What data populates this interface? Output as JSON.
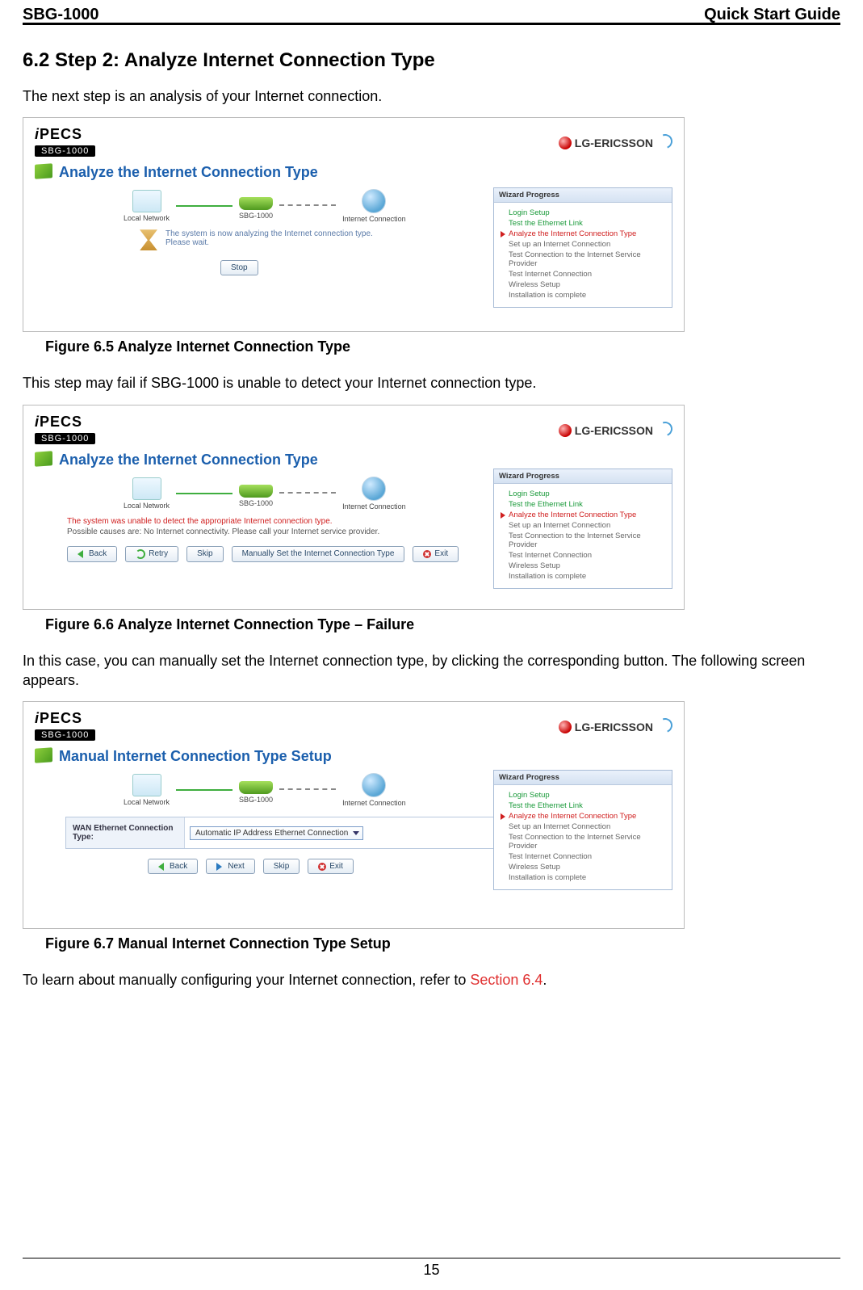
{
  "header": {
    "left": "SBG-1000",
    "right": "Quick Start Guide"
  },
  "section_title": "6.2 Step 2: Analyze Internet Connection Type",
  "para1": "The next step is an analysis of your Internet connection.",
  "caption1": "Figure 6.5 Analyze Internet Connection Type",
  "para2": "This step may fail if SBG-1000 is unable to detect your Internet connection type.",
  "caption2": "Figure 6.6 Analyze Internet Connection Type – Failure",
  "para3": "In this case, you can manually set the Internet connection type, by clicking the corresponding button. The following screen appears.",
  "caption3": "Figure 6.7 Manual Internet Connection Type Setup",
  "para4_a": "To learn about manually configuring your Internet connection, refer to ",
  "para4_link": "Section 6.4",
  "para4_b": ".",
  "page_number": "15",
  "brand": {
    "ipecs_html": "iPECS",
    "sbg": "SBG-1000",
    "lge": "LG-ERICSSON"
  },
  "topo": {
    "local": "Local Network",
    "router": "SBG-1000",
    "inet": "Internet Connection"
  },
  "wizard": {
    "title": "Wizard Progress",
    "items": [
      {
        "label": "Login Setup",
        "state": "done"
      },
      {
        "label": "Test the Ethernet Link",
        "state": "done"
      },
      {
        "label": "Analyze the Internet Connection Type",
        "state": "active"
      },
      {
        "label": "Set up an Internet Connection",
        "state": ""
      },
      {
        "label": "Test Connection to the Internet Service Provider",
        "state": ""
      },
      {
        "label": "Test Internet Connection",
        "state": ""
      },
      {
        "label": "Wireless Setup",
        "state": ""
      },
      {
        "label": "Installation is complete",
        "state": ""
      }
    ]
  },
  "shot1": {
    "title": "Analyze the Internet Connection Type",
    "msg_l1": "The system is now analyzing the Internet connection type.",
    "msg_l2": "Please wait.",
    "btn_stop": "Stop"
  },
  "shot2": {
    "title": "Analyze the Internet Connection Type",
    "err": "The system was unable to detect the appropriate Internet connection type.",
    "hint": "Possible causes are: No Internet connectivity. Please call your Internet service provider.",
    "btn_back": "Back",
    "btn_retry": "Retry",
    "btn_skip": "Skip",
    "btn_manual": "Manually Set the Internet Connection Type",
    "btn_exit": "Exit"
  },
  "shot3": {
    "title": "Manual Internet Connection Type Setup",
    "field_label": "WAN Ethernet Connection Type:",
    "field_value": "Automatic IP Address Ethernet Connection",
    "btn_back": "Back",
    "btn_next": "Next",
    "btn_skip": "Skip",
    "btn_exit": "Exit"
  }
}
